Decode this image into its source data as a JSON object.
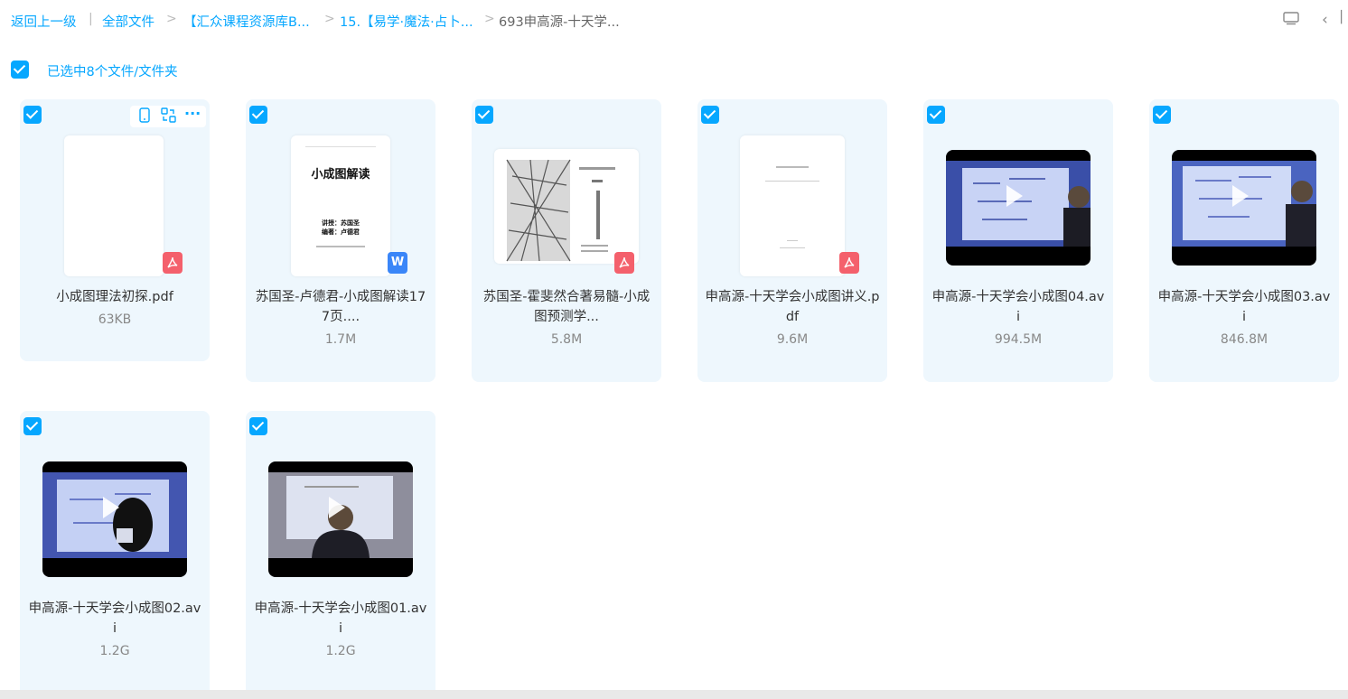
{
  "breadcrumb": {
    "back": "返回上一级",
    "items": [
      "全部文件",
      "【汇众课程资源库B...",
      "15.【易学·魔法·占卜...",
      "693申高源-十天学..."
    ]
  },
  "selection": {
    "text": "已选中8个文件/文件夹"
  },
  "files": [
    {
      "name": "小成图理法初探.pdf",
      "size": "63KB",
      "type": "pdf",
      "badge": ""
    },
    {
      "name": "苏国圣-卢德君-小成图解读177页....",
      "size": "1.7M",
      "type": "doc",
      "badge": "W",
      "cover_title": "小成图解读",
      "cover_sub1": "讲授：苏国圣",
      "cover_sub2": "编著：卢德君"
    },
    {
      "name": "苏国圣-霍斐然合著易髓-小成图预测学...",
      "size": "5.8M",
      "type": "pdf",
      "badge": ""
    },
    {
      "name": "申高源-十天学会小成图讲义.pdf",
      "size": "9.6M",
      "type": "pdf",
      "badge": ""
    },
    {
      "name": "申高源-十天学会小成图04.avi",
      "size": "994.5M",
      "type": "video"
    },
    {
      "name": "申高源-十天学会小成图03.avi",
      "size": "846.8M",
      "type": "video"
    },
    {
      "name": "申高源-十天学会小成图02.avi",
      "size": "1.2G",
      "type": "video"
    },
    {
      "name": "申高源-十天学会小成图01.avi",
      "size": "1.2G",
      "type": "video"
    }
  ],
  "colors": {
    "accent": "#06a7ff",
    "card_bg": "#eef7fd",
    "pdf": "#f4606c",
    "doc": "#3a86f8"
  }
}
